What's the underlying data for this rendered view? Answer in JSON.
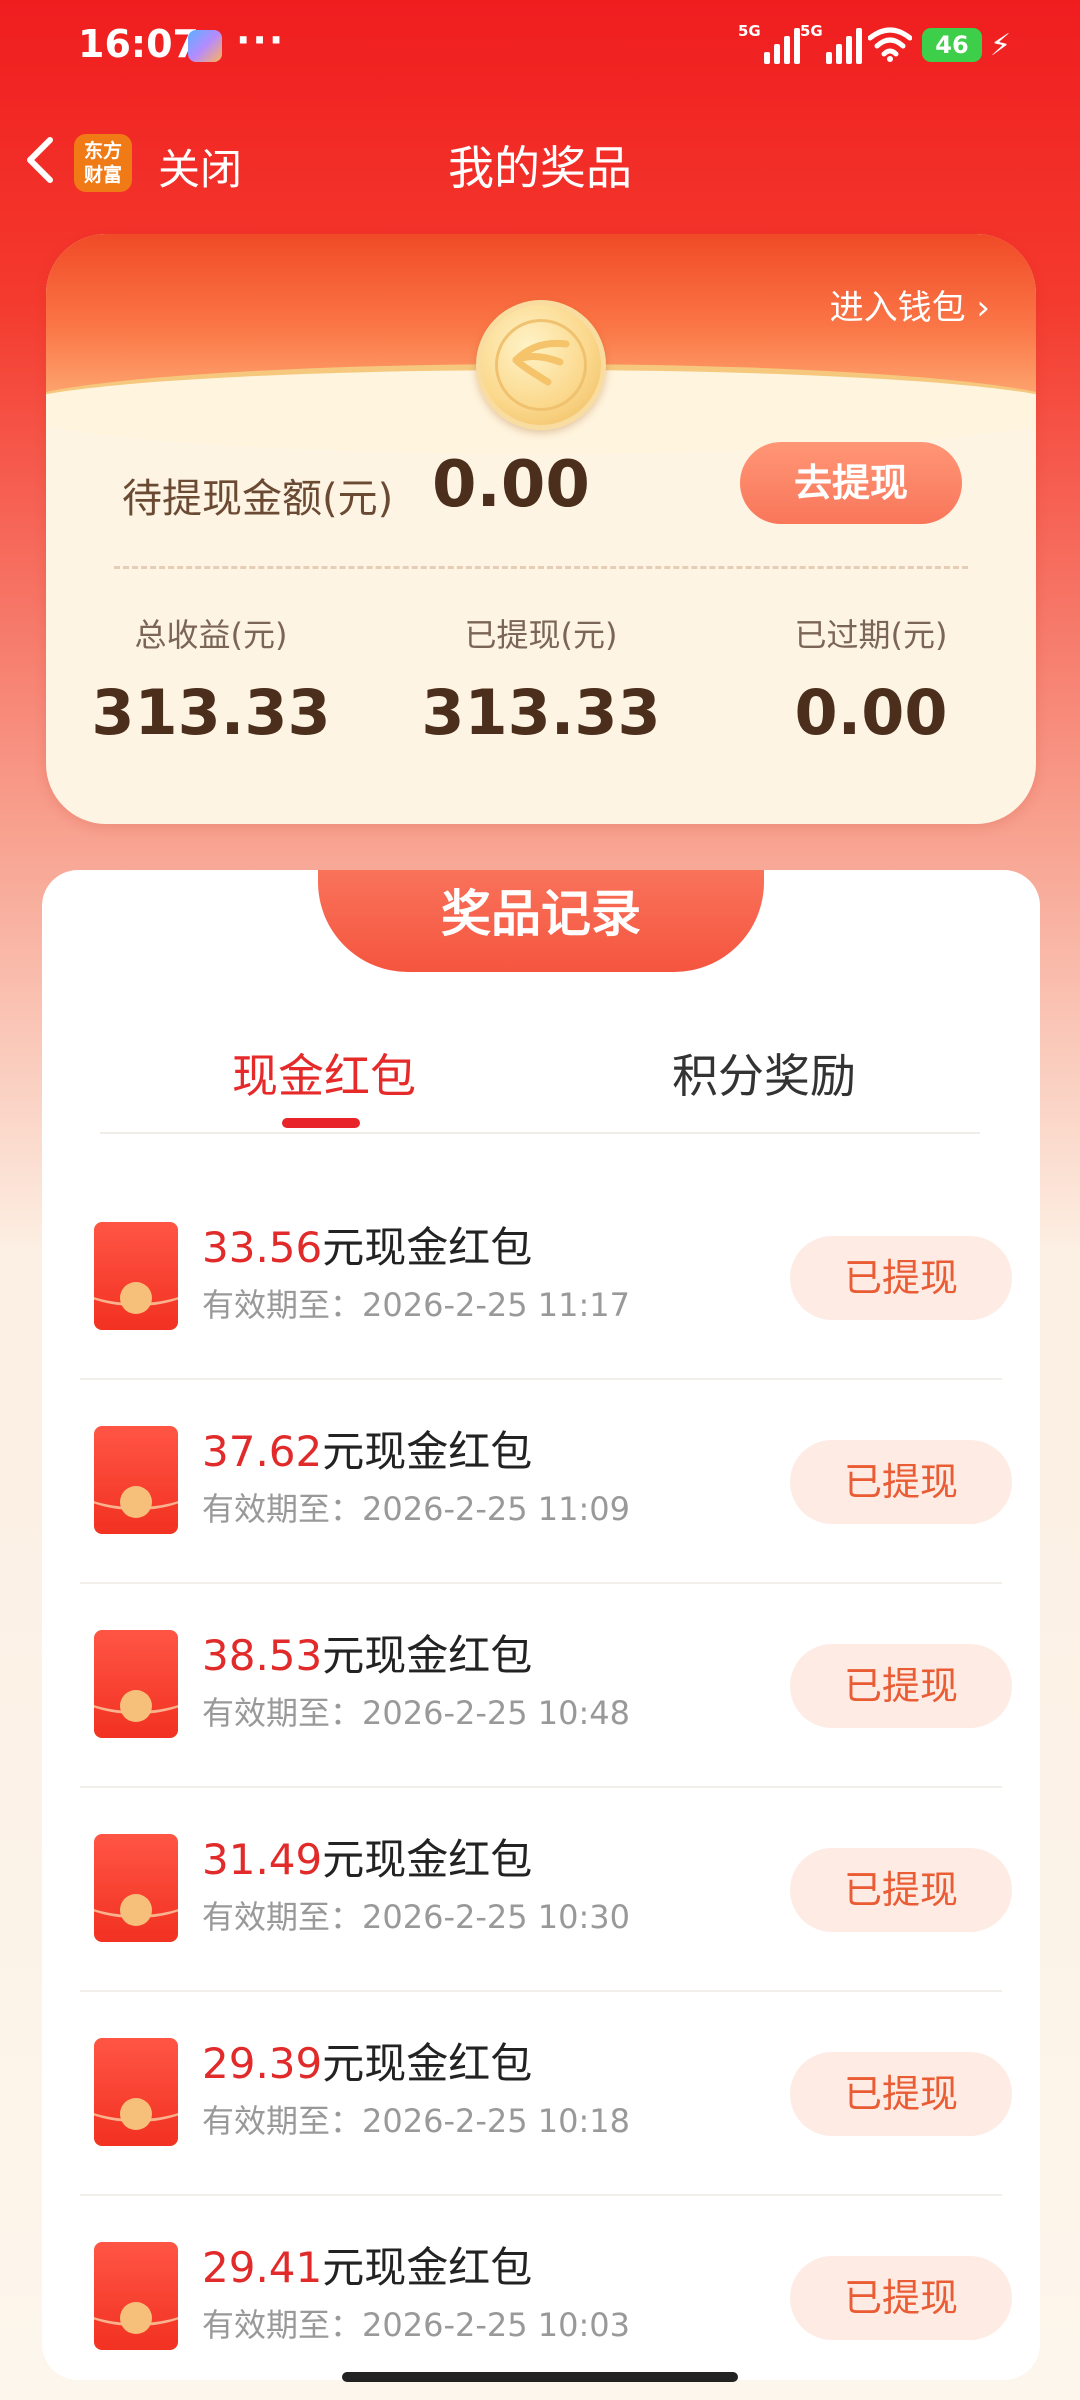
{
  "status_bar": {
    "time": "16:07",
    "dots": "···",
    "signal1": "5G",
    "signal2": "5G",
    "battery": "46"
  },
  "nav": {
    "logo_line1": "东方",
    "logo_line2": "财富",
    "close_label": "关闭",
    "title": "我的奖品"
  },
  "wallet": {
    "entry_label": "进入钱包 ›",
    "pending_label": "待提现金额(元)",
    "pending_value": "0.00",
    "withdraw_button": "去提现",
    "stats": [
      {
        "label": "总收益(元)",
        "value": "313.33"
      },
      {
        "label": "已提现(元)",
        "value": "313.33"
      },
      {
        "label": "已过期(元)",
        "value": "0.00"
      }
    ]
  },
  "records": {
    "header": "奖品记录",
    "tabs": [
      {
        "label": "现金红包",
        "active": true
      },
      {
        "label": "积分奖励",
        "active": false
      }
    ],
    "items": [
      {
        "amount": "33.56",
        "suffix": "元现金红包",
        "date": "有效期至：2026-2-25 11:17",
        "status": "已提现"
      },
      {
        "amount": "37.62",
        "suffix": "元现金红包",
        "date": "有效期至：2026-2-25 11:09",
        "status": "已提现"
      },
      {
        "amount": "38.53",
        "suffix": "元现金红包",
        "date": "有效期至：2026-2-25 10:48",
        "status": "已提现"
      },
      {
        "amount": "31.49",
        "suffix": "元现金红包",
        "date": "有效期至：2026-2-25 10:30",
        "status": "已提现"
      },
      {
        "amount": "29.39",
        "suffix": "元现金红包",
        "date": "有效期至：2026-2-25 10:18",
        "status": "已提现"
      },
      {
        "amount": "29.41",
        "suffix": "元现金红包",
        "date": "有效期至：2026-2-25 10:03",
        "status": "已提现"
      }
    ]
  }
}
